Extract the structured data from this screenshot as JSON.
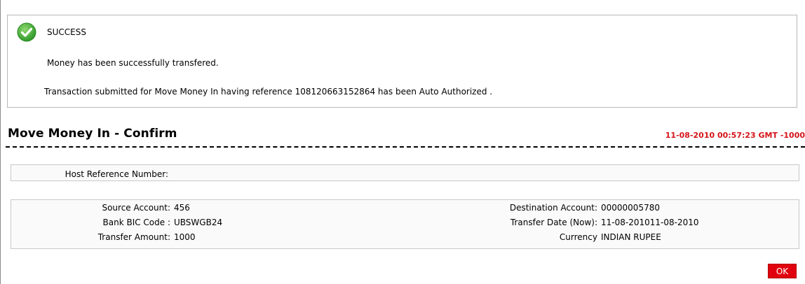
{
  "alert": {
    "status_icon": "success-check-icon",
    "title": "SUCCESS",
    "message": "Money has been successfully transfered.",
    "detail": "Transaction submitted for Move Money In having reference 108120663152864 has been Auto Authorized ."
  },
  "page": {
    "title": "Move Money In - Confirm",
    "timestamp": "11-08-2010 00:57:23 GMT -1000"
  },
  "host": {
    "label": "Host Reference Number:",
    "value": ""
  },
  "details": {
    "rows": [
      {
        "left_label": "Source Account:",
        "left_value": "456",
        "right_label": "Destination Account:",
        "right_value": "00000005780"
      },
      {
        "left_label": "Bank BIC Code :",
        "left_value": "UBSWGB24",
        "right_label": "Transfer Date (Now):",
        "right_value": "11-08-201011-08-2010"
      },
      {
        "left_label": "Transfer Amount:",
        "left_value": "1000",
        "right_label": "Currency",
        "right_value": "INDIAN RUPEE"
      }
    ]
  },
  "actions": {
    "ok_label": "OK"
  },
  "colors": {
    "timestamp": "#d4141a",
    "ok_button": "#e0030f",
    "success_icon": "#3aa534"
  }
}
